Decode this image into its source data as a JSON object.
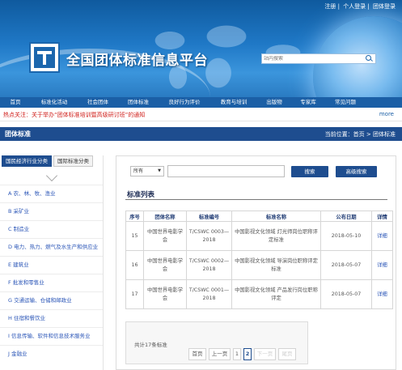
{
  "top_links": {
    "register": "注册",
    "personal_login": "个人登录",
    "group_login": "团体登录"
  },
  "site": {
    "title": "全国团体标准信息平台"
  },
  "search": {
    "placeholder": "站内搜索"
  },
  "nav": {
    "items": [
      "首页",
      "标准化活动",
      "社会团体",
      "团体标准",
      "良好行为评价",
      "教育与培训",
      "出版物",
      "专家库",
      "常见问题"
    ]
  },
  "notice": {
    "label": "热点关注：",
    "text": "关于举办“团体标准培训暨高级研讨班”的通知",
    "more": "more"
  },
  "section": {
    "title": "团体标准",
    "breadcrumb": "当前位置：首页 > 团体标准"
  },
  "sidebar": {
    "tab_active": "国民经济行业分类",
    "tab_inactive": "国际标准分类",
    "categories": [
      "A 农、林、牧、渔业",
      "B 采矿业",
      "C 制造业",
      "D 电力、热力、燃气及水生产和供应业",
      "E 建筑业",
      "F 批发和零售业",
      "G 交通运输、仓储和邮政业",
      "H 住宿和餐饮业",
      "I 信息传输、软件和信息技术服务业",
      "J 金融业"
    ]
  },
  "filter": {
    "selected": "所有",
    "search_button": "搜索",
    "advanced_button": "高级搜索"
  },
  "list": {
    "title": "标准列表",
    "headers": [
      "序号",
      "团体名称",
      "标准编号",
      "标准名称",
      "公布日期",
      "详情"
    ],
    "rows": [
      {
        "no": "15",
        "org": "中国世界电影学会",
        "code": "T/CSWC 0003—2018",
        "name": "中国影视文化领域 灯光师岗位职称评定标准",
        "date": "2018-05-10",
        "detail": "详细"
      },
      {
        "no": "16",
        "org": "中国世界电影学会",
        "code": "T/CSWC 0002—2018",
        "name": "中国影视文化领域 导演岗位职称评定标准",
        "date": "2018-05-07",
        "detail": "详细"
      },
      {
        "no": "17",
        "org": "中国世界电影学会",
        "code": "T/CSWC 0001—2018",
        "name": "中国影视文化领域 产品发行岗位职称评定",
        "date": "2018-05-07",
        "detail": "详细"
      }
    ]
  },
  "pager": {
    "total": "共计17条标准",
    "first": "首页",
    "prev": "上一页",
    "page1": "1",
    "page2": "2",
    "next": "下一页",
    "last": "尾页"
  }
}
